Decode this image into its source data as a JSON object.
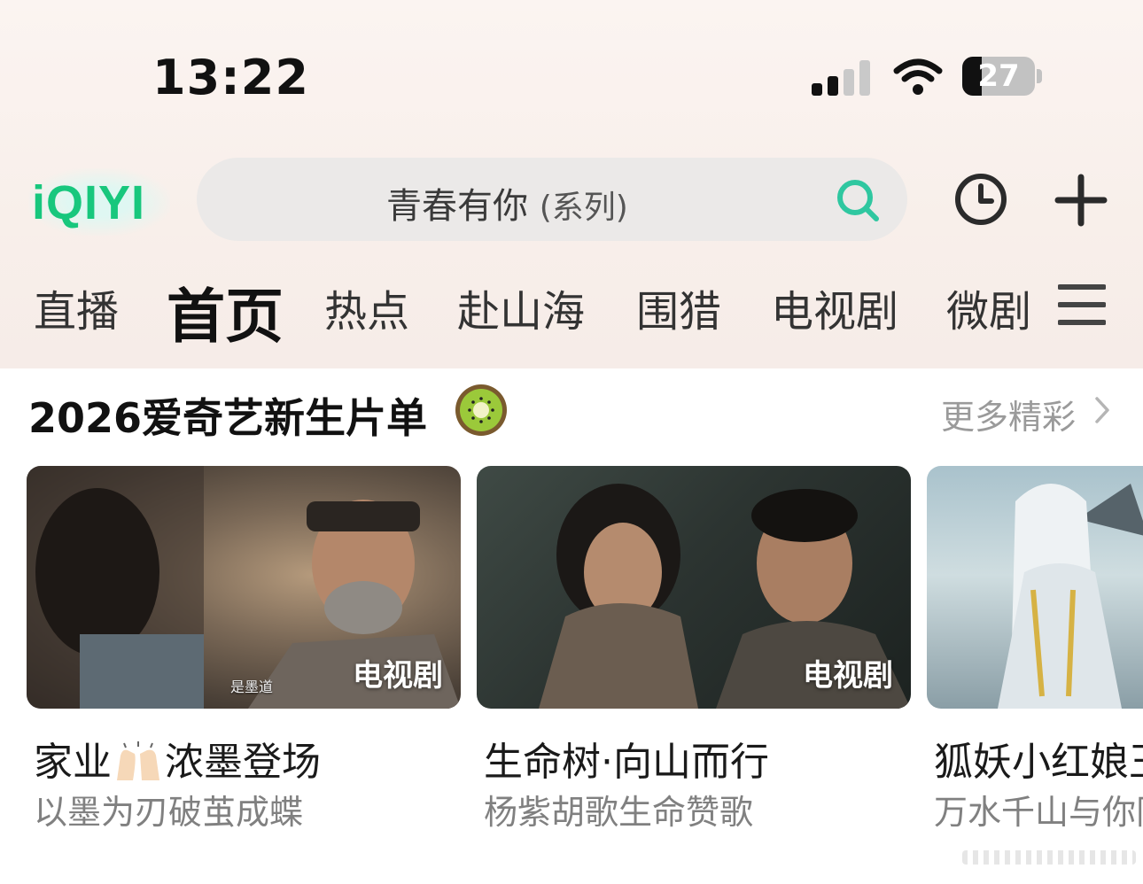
{
  "status_bar": {
    "time": "13:22",
    "battery": "27",
    "battery_level": 0.27
  },
  "header": {
    "logo_text": "iQIYI",
    "search_text": "青春有你",
    "search_suffix": "(系列)"
  },
  "tabs": [
    {
      "label": "直播",
      "active": false
    },
    {
      "label": "首页",
      "active": true
    },
    {
      "label": "热点",
      "active": false
    },
    {
      "label": "赴山海",
      "active": false
    },
    {
      "label": "围猎",
      "active": false
    },
    {
      "label": "电视剧",
      "active": false
    },
    {
      "label": "微剧",
      "active": false
    }
  ],
  "section": {
    "title": "2026爱奇艺新生片单",
    "more": "更多精彩"
  },
  "cards": [
    {
      "title_a": "家业",
      "title_b": "浓墨登场",
      "desc": "以墨为刃破茧成蝶",
      "badge": "电视剧",
      "caption": "是墨道"
    },
    {
      "title": "生命树·向山而行",
      "desc": "杨紫胡歌生命赞歌",
      "badge": "电视剧"
    },
    {
      "title": "狐妖小红娘王",
      "desc": "万水千山与你同"
    }
  ],
  "colors": {
    "brand": "#18c77d",
    "search_icon": "#2fc7a0"
  }
}
